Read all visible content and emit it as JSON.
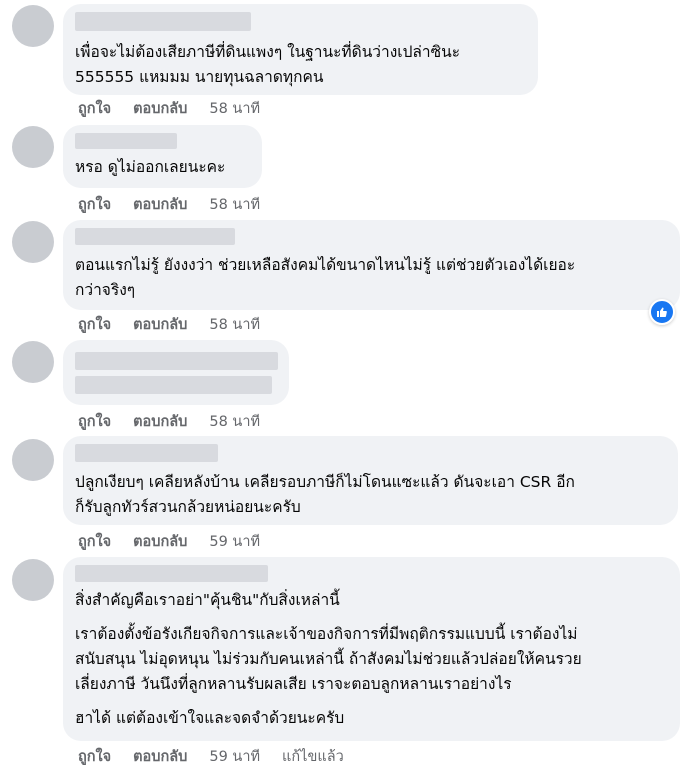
{
  "actions": {
    "like": "ถูกใจ",
    "reply": "ตอบกลับ",
    "edited": "แก้ไขแล้ว"
  },
  "comments": [
    {
      "text": [
        "เพื่อจะไม่ต้องเสียภาษีที่ดินแพงๆ ในฐานะที่ดินว่างเปล่าซินะ",
        "555555 แหมมม นายทุนฉลาดทุกคน"
      ],
      "time": "58 นาที"
    },
    {
      "text": [
        "หรอ ดูไม่ออกเลยนะคะ"
      ],
      "time": "58 นาที"
    },
    {
      "text": [
        "ตอนแรกไม่รู้ ยังงงว่า ช่วยเหลือสังคมได้ขนาดไหนไม่รู้ แต่ช่วยตัวเองได้เยอะ",
        "กว่าจริงๆ"
      ],
      "time": "58 นาที",
      "reaction": "like-icon"
    },
    {
      "text": [],
      "time": "58 นาที"
    },
    {
      "text": [
        "ปลูกเงียบๆ เคลียหลังบ้าน เคลียรอบภาษีก็ไม่โดนแซะแล้ว ดันจะเอา CSR อีก",
        "ก็รับลูกทัวร์สวนกล้วยหน่อยนะครับ"
      ],
      "time": "59 นาที"
    },
    {
      "paragraphs": [
        [
          "สิ่งสำคัญคือเราอย่า\"คุ้นชิน\"กับสิ่งเหล่านี้"
        ],
        [
          "เราต้องตั้งข้อรังเกียจกิจการและเจ้าของกิจการที่มีพฤติกรรมแบบนี้ เราต้องไม่",
          "สนับสนุน ไม่อุดหนุน ไม่ร่วมกับคนเหล่านี้ ถ้าสังคมไม่ช่วยแล้วปล่อยให้คนรวย",
          "เลี่ยงภาษี วันนึงที่ลูกหลานรับผลเสีย เราจะตอบลูกหลานเราอย่างไร"
        ],
        [
          "ฮาได้ แต่ต้องเข้าใจและจดจำด้วยนะครับ"
        ]
      ],
      "time": "59 นาที",
      "edited": true
    }
  ]
}
